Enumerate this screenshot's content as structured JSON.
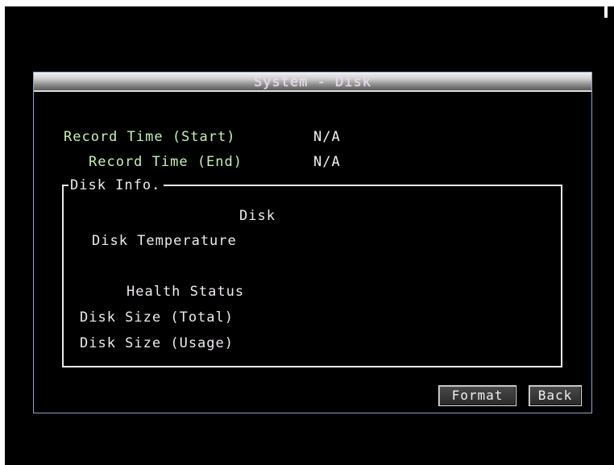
{
  "window": {
    "title": "System - Disk"
  },
  "record": {
    "start_label": "Record Time (Start)",
    "start_value": "N/A",
    "end_label": "Record Time (End)",
    "end_value": "N/A"
  },
  "disk_info": {
    "legend": "Disk Info.",
    "disk_label": "Disk",
    "temperature_label": "Disk Temperature",
    "health_label": "Health Status",
    "size_total_label": "Disk Size (Total)",
    "size_usage_label": "Disk Size (Usage)"
  },
  "buttons": {
    "format_label": "Format",
    "back_label": "Back"
  },
  "colors": {
    "background": "#000000",
    "label_green": "#c9f0b4",
    "label_white": "#efe9ef",
    "dialog_border": "#8ea4c8",
    "title_text": "#e7d2ef"
  }
}
